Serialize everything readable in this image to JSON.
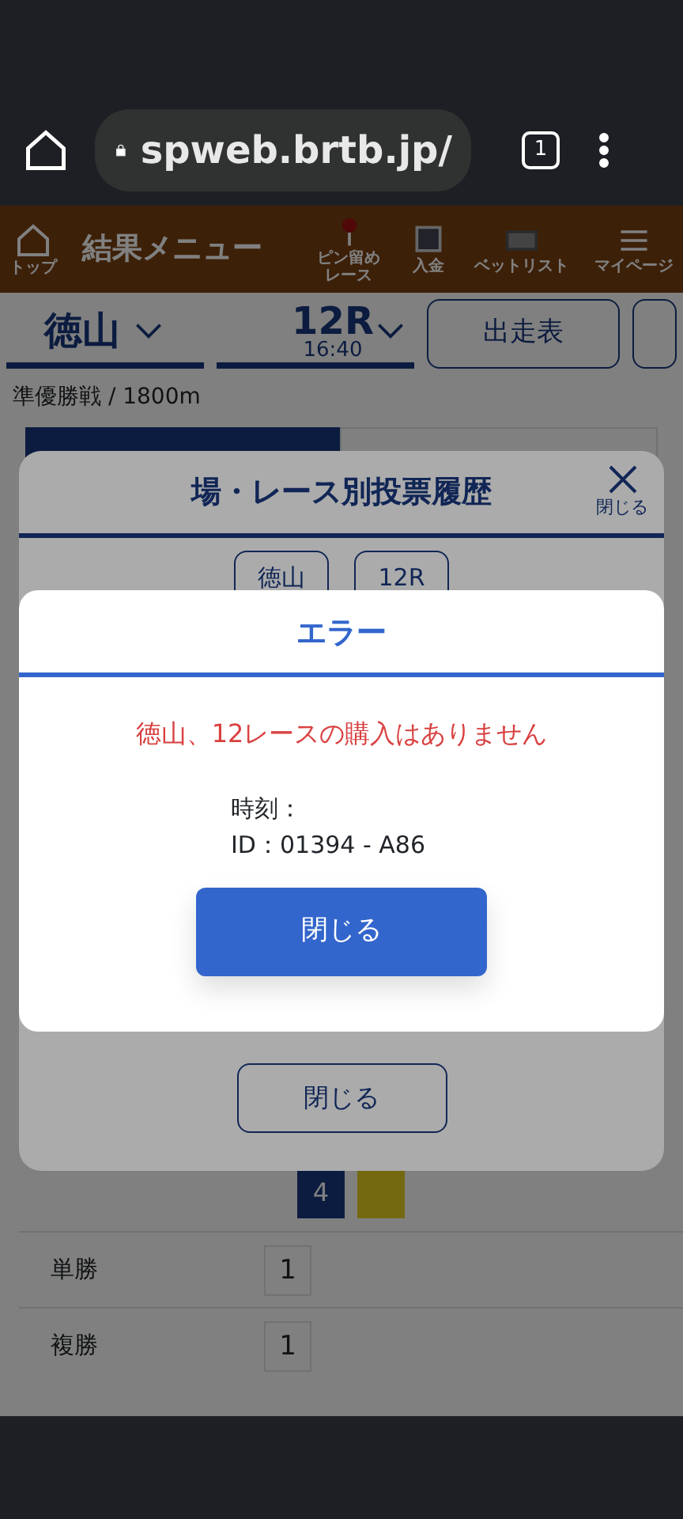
{
  "browser": {
    "url": "spweb.brtb.jp/",
    "tab_count": "1"
  },
  "header": {
    "title": "結果メニュー",
    "home_label": "トップ",
    "actions": [
      {
        "kind": "pin",
        "label": "ピン留めレース"
      },
      {
        "kind": "deposit",
        "label": "入金"
      },
      {
        "kind": "betlist",
        "label": "ベットリスト"
      },
      {
        "kind": "menu",
        "label": "マイページ"
      }
    ]
  },
  "selectors": {
    "venue": "徳山",
    "race": "12R",
    "race_time": "16:40",
    "button": "出走表"
  },
  "breadcrumb": "準優勝戦 / 1800m",
  "table": {
    "rows": [
      {
        "label": "単勝",
        "value": "1"
      },
      {
        "label": "複勝",
        "value": "1"
      }
    ],
    "combo": "4"
  },
  "history_modal": {
    "title": "場・レース別投票履歴",
    "close_label": "閉じる",
    "filters": [
      "徳山",
      "12R"
    ],
    "footer_button": "閉じる"
  },
  "error_modal": {
    "title": "エラー",
    "message": "徳山、12レースの購入はありません",
    "lines": [
      {
        "label": "時刻："
      },
      {
        "label": "ID：",
        "value": "01394 - A86"
      }
    ],
    "button": "閉じる"
  }
}
